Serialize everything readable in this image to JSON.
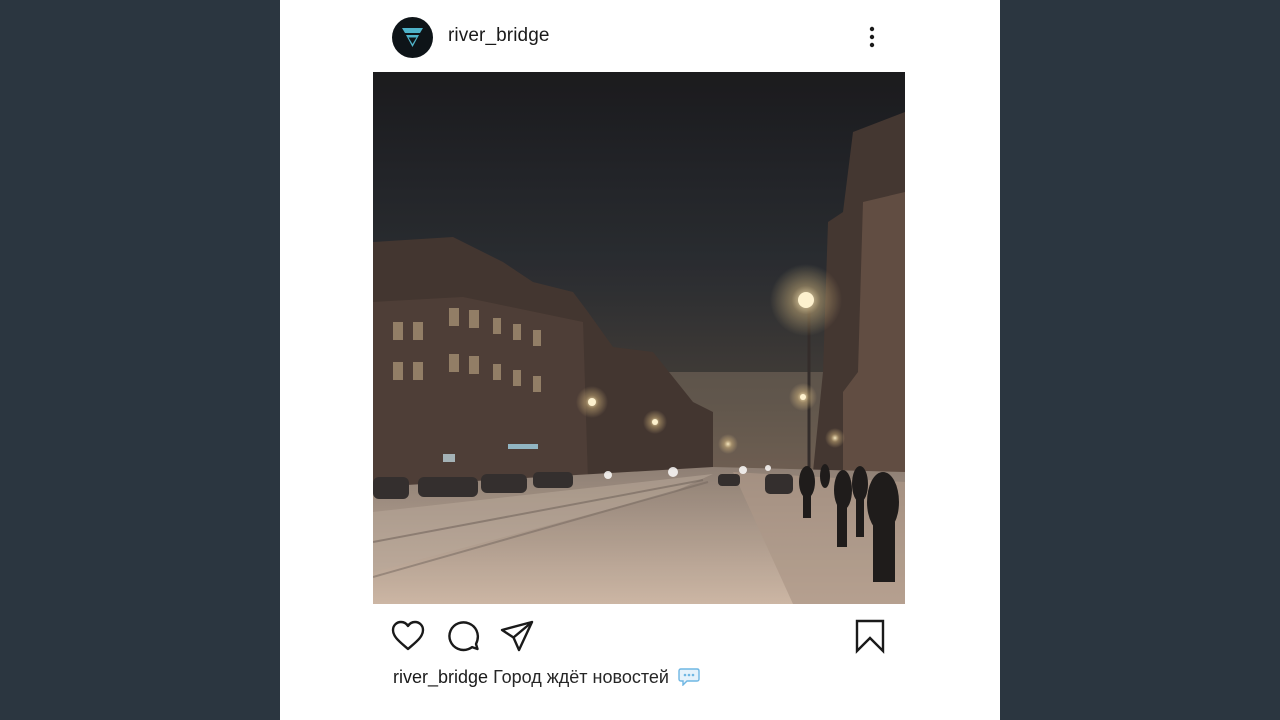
{
  "post": {
    "username": "river_bridge",
    "avatar_icon": "logo-chevron-icon",
    "more_icon": "more-vertical-icon",
    "photo_alt": "",
    "actions": {
      "like_icon": "heart-icon",
      "comment_icon": "comment-icon",
      "share_icon": "send-icon",
      "save_icon": "bookmark-icon"
    },
    "caption": {
      "username": "river_bridge",
      "text": "Город ждёт новостей",
      "emoji_icon": "speech-bubble-icon"
    }
  },
  "colors": {
    "background": "#2b3640",
    "card": "#ffffff",
    "text": "#1a1a1a",
    "avatar_bg": "#0e1418",
    "avatar_accent": "#4fb3c9",
    "emoji_accent": "#6fb7e3"
  }
}
